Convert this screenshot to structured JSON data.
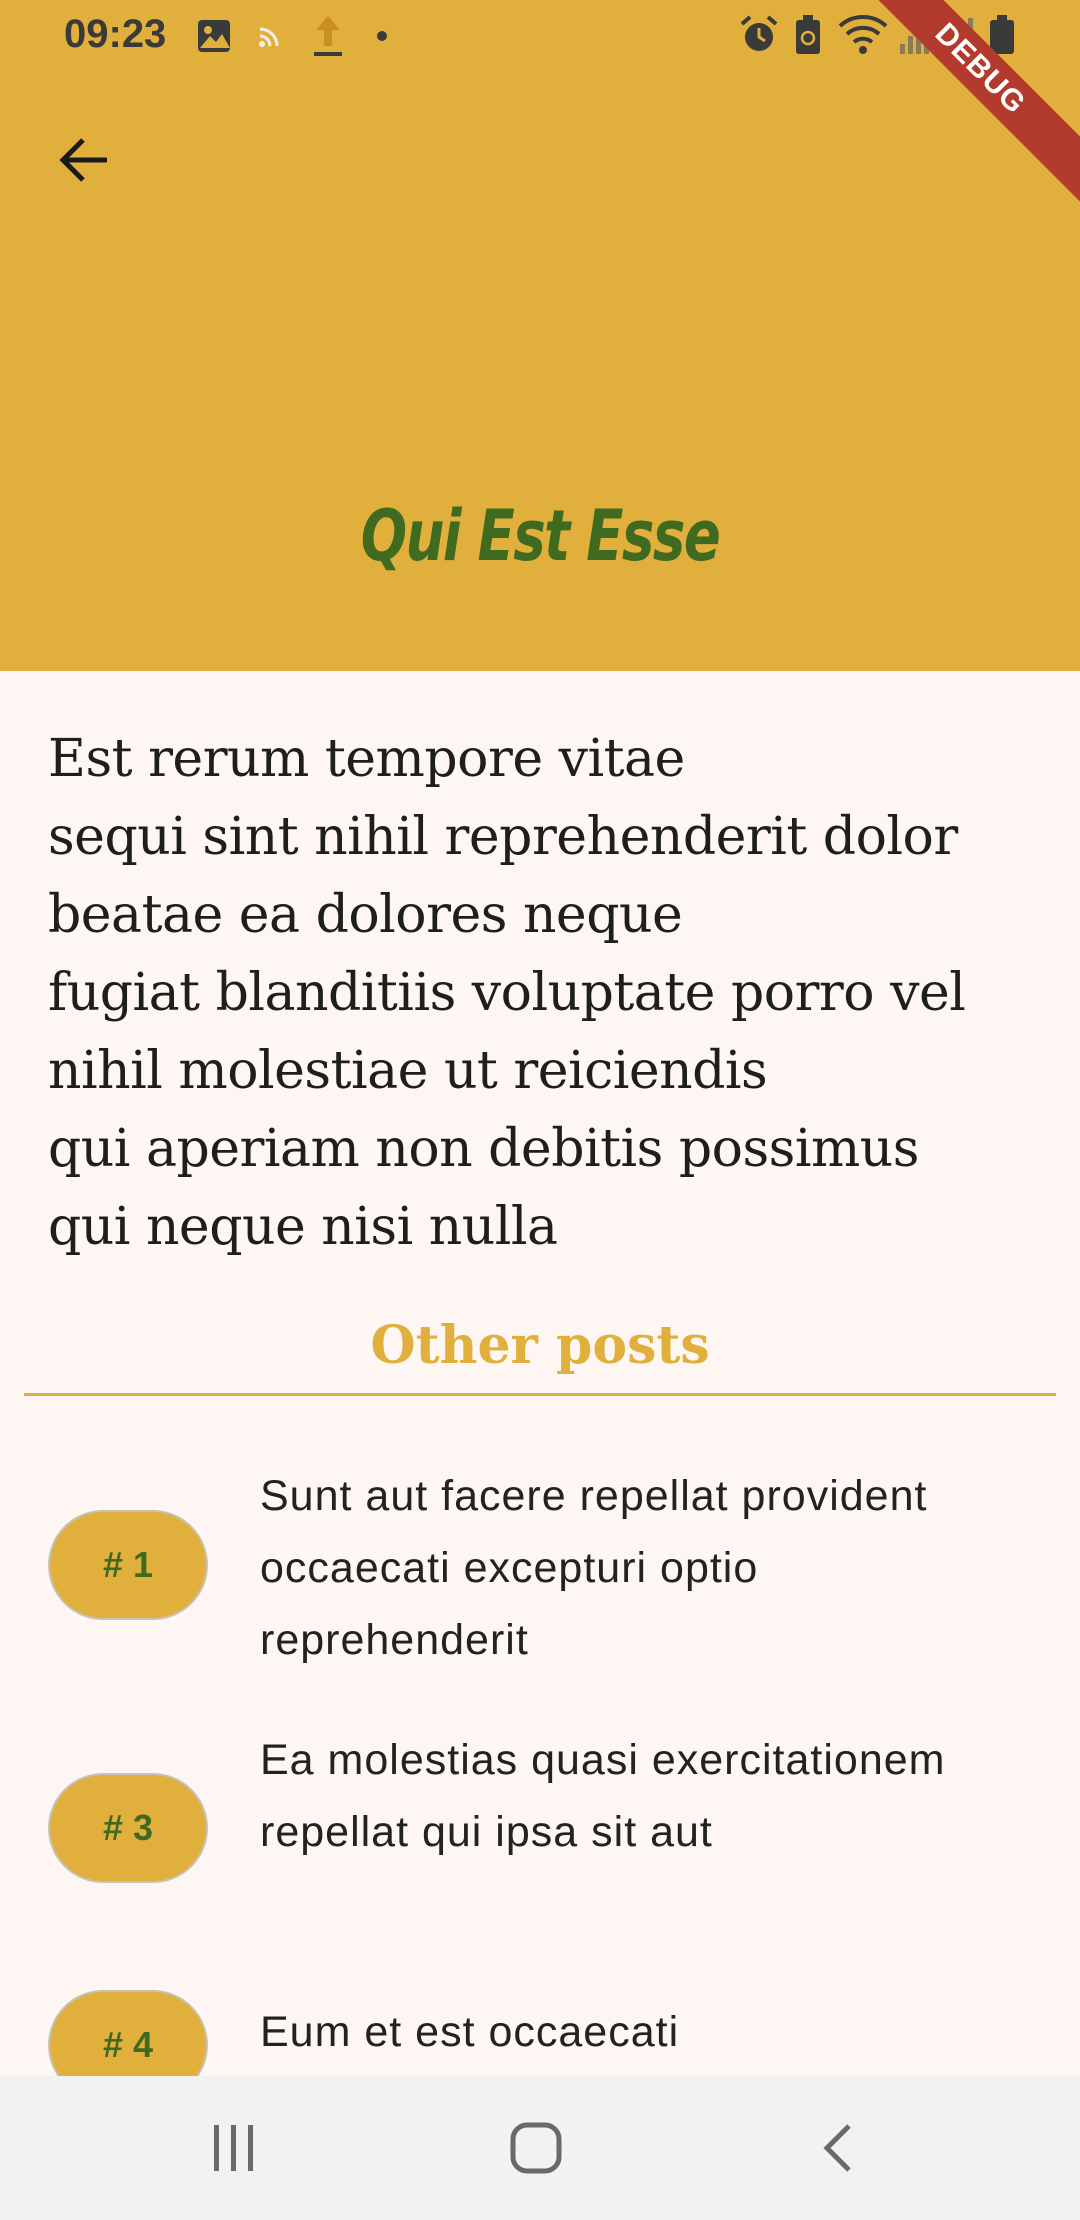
{
  "status_bar": {
    "time": "09:23"
  },
  "debug_banner": "DEBUG",
  "app_bar": {
    "title": "Qui Est Esse",
    "back_icon": "arrow-back-icon"
  },
  "post": {
    "body": "Est rerum tempore vitae\nsequi sint nihil reprehenderit dolor\nbeatae ea dolores neque\nfugiat blanditiis voluptate porro vel\nnihil molestiae ut reiciendis\nqui aperiam non debitis possimus\nqui neque nisi nulla"
  },
  "other_posts": {
    "header": "Other posts",
    "items": [
      {
        "badge": "# 1",
        "title": "Sunt aut facere repellat provident occaecati excepturi optio reprehenderit"
      },
      {
        "badge": "# 3",
        "title": "Ea molestias quasi exercitationem repellat qui ipsa sit aut"
      },
      {
        "badge": "# 4",
        "title": "Eum et est occaecati"
      }
    ]
  },
  "colors": {
    "accent": "#E1AF3C",
    "title_green": "#3F6A1F",
    "background": "#FDF6F3"
  },
  "nav_bar": {
    "icons": [
      "recent-apps-icon",
      "home-icon",
      "back-icon"
    ]
  }
}
